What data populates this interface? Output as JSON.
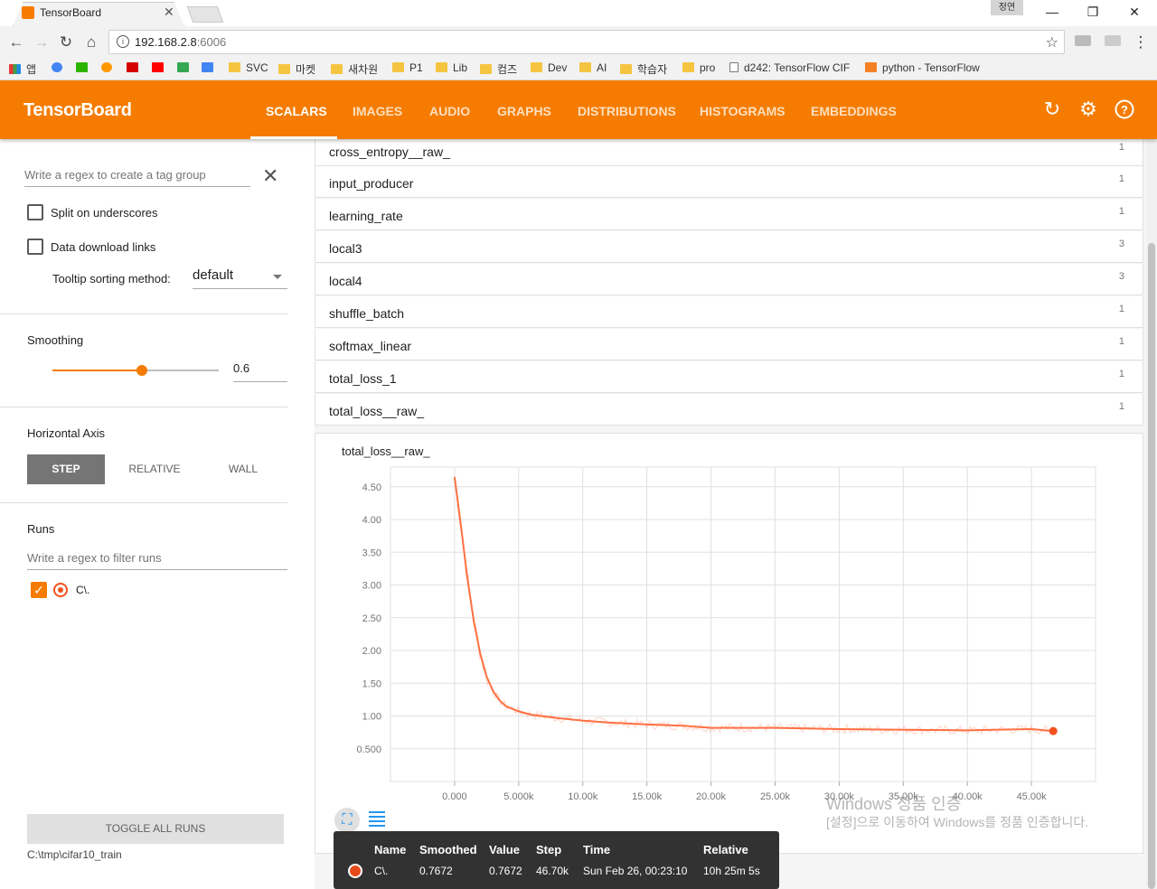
{
  "browser": {
    "tab_title": "TensorBoard",
    "user_label": "정연",
    "url_host": "192.168.2.8",
    "url_port": ":6006",
    "bookmarks": [
      "앱",
      "SVC",
      "마켓",
      "새차원",
      "P1",
      "Lib",
      "컴즈",
      "Dev",
      "AI",
      "학습자",
      "pro",
      "d242: TensorFlow CIF",
      "python - TensorFlow"
    ]
  },
  "header": {
    "title": "TensorBoard",
    "tabs": [
      "SCALARS",
      "IMAGES",
      "AUDIO",
      "GRAPHS",
      "DISTRIBUTIONS",
      "HISTOGRAMS",
      "EMBEDDINGS"
    ],
    "active_tab": "SCALARS",
    "accent_color": "#f57c00"
  },
  "sidebar": {
    "regex_placeholder": "Write a regex to create a tag group",
    "split_label": "Split on underscores",
    "download_label": "Data download links",
    "tooltip_sort_label": "Tooltip sorting method:",
    "tooltip_sort_value": "default",
    "smoothing_label": "Smoothing",
    "smoothing_value": "0.6",
    "smoothing_fraction": 0.6,
    "horizontal_axis_label": "Horizontal Axis",
    "axis_buttons": [
      "STEP",
      "RELATIVE",
      "WALL"
    ],
    "runs_label": "Runs",
    "runs_filter_placeholder": "Write a regex to filter runs",
    "run_name": "C\\.",
    "toggle_all": "TOGGLE ALL RUNS",
    "logdir": "C:\\tmp\\cifar10_train"
  },
  "tags": [
    {
      "name": "cross_entropy__raw_",
      "count": "1"
    },
    {
      "name": "input_producer",
      "count": "1"
    },
    {
      "name": "learning_rate",
      "count": "1"
    },
    {
      "name": "local3",
      "count": "3"
    },
    {
      "name": "local4",
      "count": "3"
    },
    {
      "name": "shuffle_batch",
      "count": "1"
    },
    {
      "name": "softmax_linear",
      "count": "1"
    },
    {
      "name": "total_loss_1",
      "count": "1"
    },
    {
      "name": "total_loss__raw_",
      "count": "1"
    }
  ],
  "chart_data": {
    "type": "line",
    "title": "total_loss__raw_",
    "x_ticks": [
      "0.000",
      "5.000k",
      "10.00k",
      "15.00k",
      "20.00k",
      "25.00k",
      "30.00k",
      "35.00k",
      "40.00k",
      "45.00k"
    ],
    "y_ticks": [
      "4.50",
      "4.00",
      "3.50",
      "3.00",
      "2.50",
      "2.00",
      "1.50",
      "1.00",
      "0.500"
    ],
    "xlim": [
      -5000,
      50000
    ],
    "ylim": [
      0,
      4.8
    ],
    "series": [
      {
        "color": "#ff7043",
        "x": [
          0,
          500,
          1000,
          1500,
          2000,
          2500,
          3000,
          3500,
          4000,
          5000,
          6000,
          8000,
          10000,
          12000,
          15000,
          18000,
          20000,
          25000,
          30000,
          35000,
          40000,
          42000,
          45000,
          46700
        ],
        "y": [
          4.65,
          3.9,
          3.1,
          2.45,
          1.95,
          1.6,
          1.38,
          1.24,
          1.15,
          1.07,
          1.02,
          0.97,
          0.93,
          0.9,
          0.87,
          0.85,
          0.82,
          0.82,
          0.8,
          0.79,
          0.78,
          0.79,
          0.8,
          0.77
        ]
      }
    ]
  },
  "tooltip": {
    "headers": [
      "Name",
      "Smoothed",
      "Value",
      "Step",
      "Time",
      "Relative"
    ],
    "values": [
      "C\\.",
      "0.7672",
      "0.7672",
      "46.70k",
      "Sun Feb 26, 00:23:10",
      "10h 25m 5s"
    ]
  },
  "watermark": {
    "line1": "Windows 정품 인증",
    "line2": "[설정]으로 이동하여 Windows를 정품 인증합니다."
  }
}
